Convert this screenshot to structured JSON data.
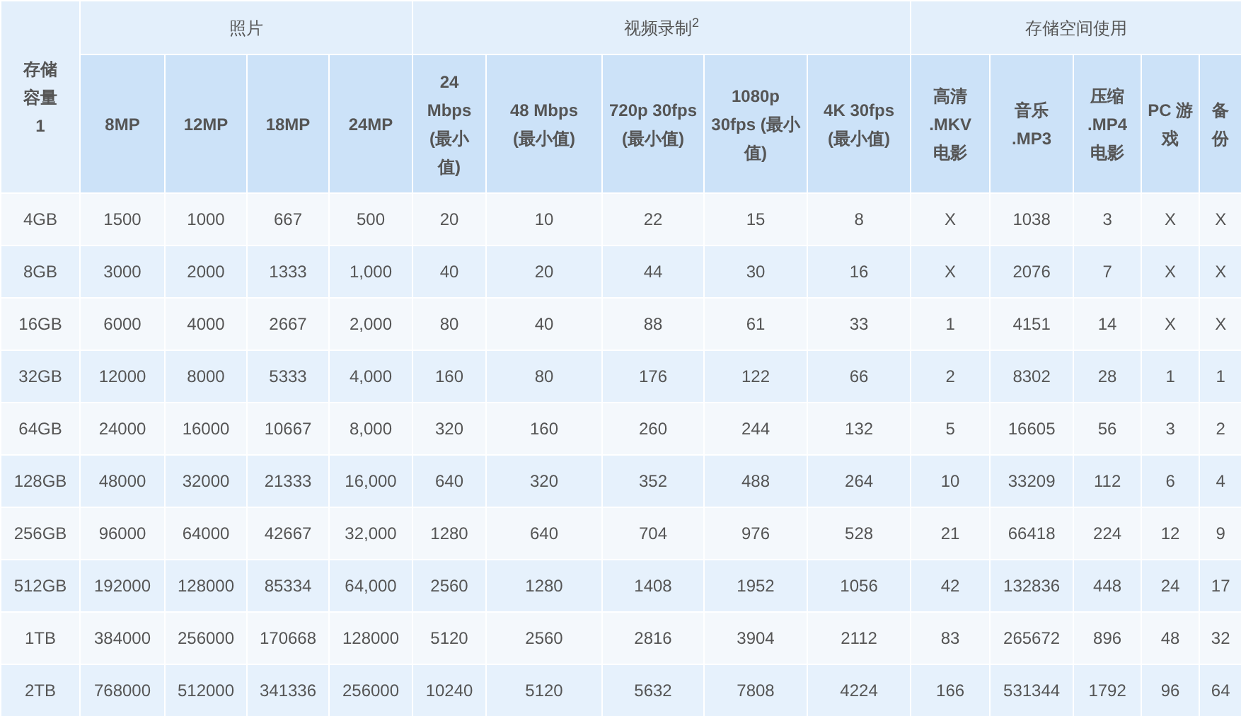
{
  "table": {
    "column_groups": [
      {
        "label": "照片"
      },
      {
        "label": "视频录制$^{2}$"
      },
      {
        "label": "存储空间使用"
      }
    ],
    "columns": [
      "存储容量1",
      "8MP",
      "12MP",
      "18MP",
      "24MP",
      "24 Mbps (最小值)",
      "48 Mbps (最小值)",
      "720p 30fps (最小值)",
      "1080p 30fps (最小值)",
      "4K 30fps (最小值)",
      "高清 .MKV 电影",
      "音乐 .MP3",
      "压缩 .MP4 电影",
      "PC 游戏",
      "备份"
    ],
    "rows": [
      [
        "4GB",
        "1500",
        "1000",
        "667",
        "500",
        "20",
        "10",
        "22",
        "15",
        "8",
        "X",
        "1038",
        "3",
        "X",
        "X"
      ],
      [
        "8GB",
        "3000",
        "2000",
        "1333",
        "1,000",
        "40",
        "20",
        "44",
        "30",
        "16",
        "X",
        "2076",
        "7",
        "X",
        "X"
      ],
      [
        "16GB",
        "6000",
        "4000",
        "2667",
        "2,000",
        "80",
        "40",
        "88",
        "61",
        "33",
        "1",
        "4151",
        "14",
        "X",
        "X"
      ],
      [
        "32GB",
        "12000",
        "8000",
        "5333",
        "4,000",
        "160",
        "80",
        "176",
        "122",
        "66",
        "2",
        "8302",
        "28",
        "1",
        "1"
      ],
      [
        "64GB",
        "24000",
        "16000",
        "10667",
        "8,000",
        "320",
        "160",
        "260",
        "244",
        "132",
        "5",
        "16605",
        "56",
        "3",
        "2"
      ],
      [
        "128GB",
        "48000",
        "32000",
        "21333",
        "16,000",
        "640",
        "320",
        "352",
        "488",
        "264",
        "10",
        "33209",
        "112",
        "6",
        "4"
      ],
      [
        "256GB",
        "96000",
        "64000",
        "42667",
        "32,000",
        "1280",
        "640",
        "704",
        "976",
        "528",
        "21",
        "66418",
        "224",
        "12",
        "9"
      ],
      [
        "512GB",
        "192000",
        "128000",
        "85334",
        "64,000",
        "2560",
        "1280",
        "1408",
        "1952",
        "1056",
        "42",
        "132836",
        "448",
        "24",
        "17"
      ],
      [
        "1TB",
        "384000",
        "256000",
        "170668",
        "128000",
        "5120",
        "2560",
        "2816",
        "3904",
        "2112",
        "83",
        "265672",
        "896",
        "48",
        "32"
      ],
      [
        "2TB",
        "768000",
        "512000",
        "341336",
        "256000",
        "10240",
        "5120",
        "5632",
        "7808",
        "4224",
        "166",
        "531344",
        "1792",
        "96",
        "64"
      ]
    ]
  }
}
